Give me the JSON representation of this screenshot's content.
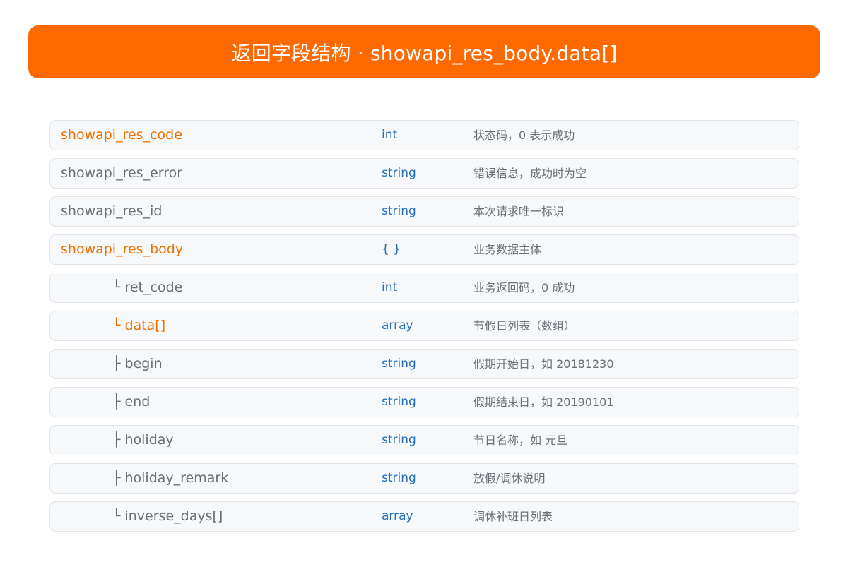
{
  "header": {
    "title": "返回字段结构 · showapi_res_body.data[]"
  },
  "colors": {
    "accent": "#ff6a00",
    "highlight_field": "#f07000",
    "type_text": "#1f6fb8",
    "row_background": "#f6f8fa"
  },
  "rows": [
    {
      "field": "showapi_res_code",
      "type": "int",
      "desc": "状态码，0 表示成功"
    },
    {
      "field": "showapi_res_error",
      "type": "string",
      "desc": "错误信息，成功时为空"
    },
    {
      "field": "showapi_res_id",
      "type": "string",
      "desc": "本次请求唯一标识"
    },
    {
      "field": "showapi_res_body",
      "type": "{ }",
      "desc": "业务数据主体"
    },
    {
      "field": "└ ret_code",
      "type": "int",
      "desc": "业务返回码，0 成功"
    },
    {
      "field": "└ data[]",
      "type": "array",
      "desc": "节假日列表（数组）"
    },
    {
      "field": "├ begin",
      "type": "string",
      "desc": "假期开始日，如 20181230"
    },
    {
      "field": "├ end",
      "type": "string",
      "desc": "假期结束日，如 20190101"
    },
    {
      "field": "├ holiday",
      "type": "string",
      "desc": "节日名称，如 元旦"
    },
    {
      "field": "├ holiday_remark",
      "type": "string",
      "desc": "放假/调休说明"
    },
    {
      "field": "└ inverse_days[]",
      "type": "array",
      "desc": "调休补班日列表"
    }
  ]
}
